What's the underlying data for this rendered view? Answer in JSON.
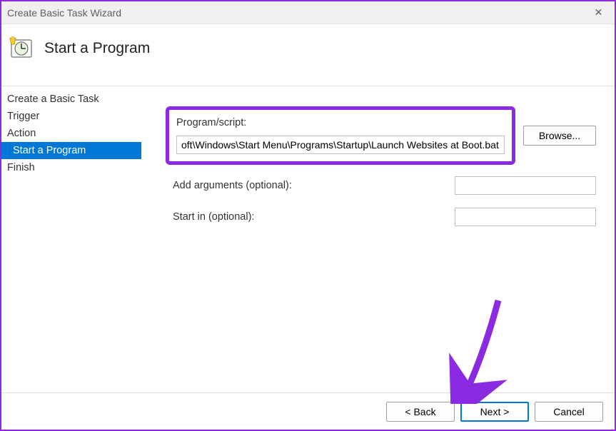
{
  "window": {
    "title": "Create Basic Task Wizard",
    "close_glyph": "✕"
  },
  "header": {
    "title": "Start a Program"
  },
  "sidebar": {
    "items": [
      {
        "label": "Create a Basic Task",
        "indent": false,
        "selected": false
      },
      {
        "label": "Trigger",
        "indent": false,
        "selected": false
      },
      {
        "label": "Action",
        "indent": false,
        "selected": false
      },
      {
        "label": "Start a Program",
        "indent": true,
        "selected": true
      },
      {
        "label": "Finish",
        "indent": false,
        "selected": false
      }
    ]
  },
  "form": {
    "program_label": "Program/script:",
    "program_value": "oft\\Windows\\Start Menu\\Programs\\Startup\\Launch Websites at Boot.bat",
    "browse_label": "Browse...",
    "args_label": "Add arguments (optional):",
    "args_value": "",
    "startin_label": "Start in (optional):",
    "startin_value": ""
  },
  "footer": {
    "back_label": "< Back",
    "next_label": "Next >",
    "cancel_label": "Cancel"
  },
  "annotations": {
    "highlight_color": "#8a2be2"
  }
}
